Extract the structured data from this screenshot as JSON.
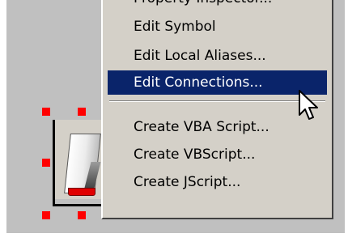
{
  "menu": {
    "items": [
      {
        "label": "Property Inspector...",
        "cut": true
      },
      {
        "label": "Edit Symbol"
      },
      {
        "label": "Edit Local Aliases..."
      },
      {
        "label": "Edit Connections...",
        "highlighted": true
      },
      {
        "label": "Create VBA Script..."
      },
      {
        "label": "Create VBScript..."
      },
      {
        "label": "Create JScript..."
      }
    ]
  },
  "colors": {
    "canvas": "#c0c0c0",
    "menu_face": "#d4d0c8",
    "highlight": "#0a246a",
    "handle": "#ff0000",
    "led": "#e00000"
  },
  "icons": [
    "arrow-cursor-icon",
    "rocker-switch-symbol"
  ]
}
